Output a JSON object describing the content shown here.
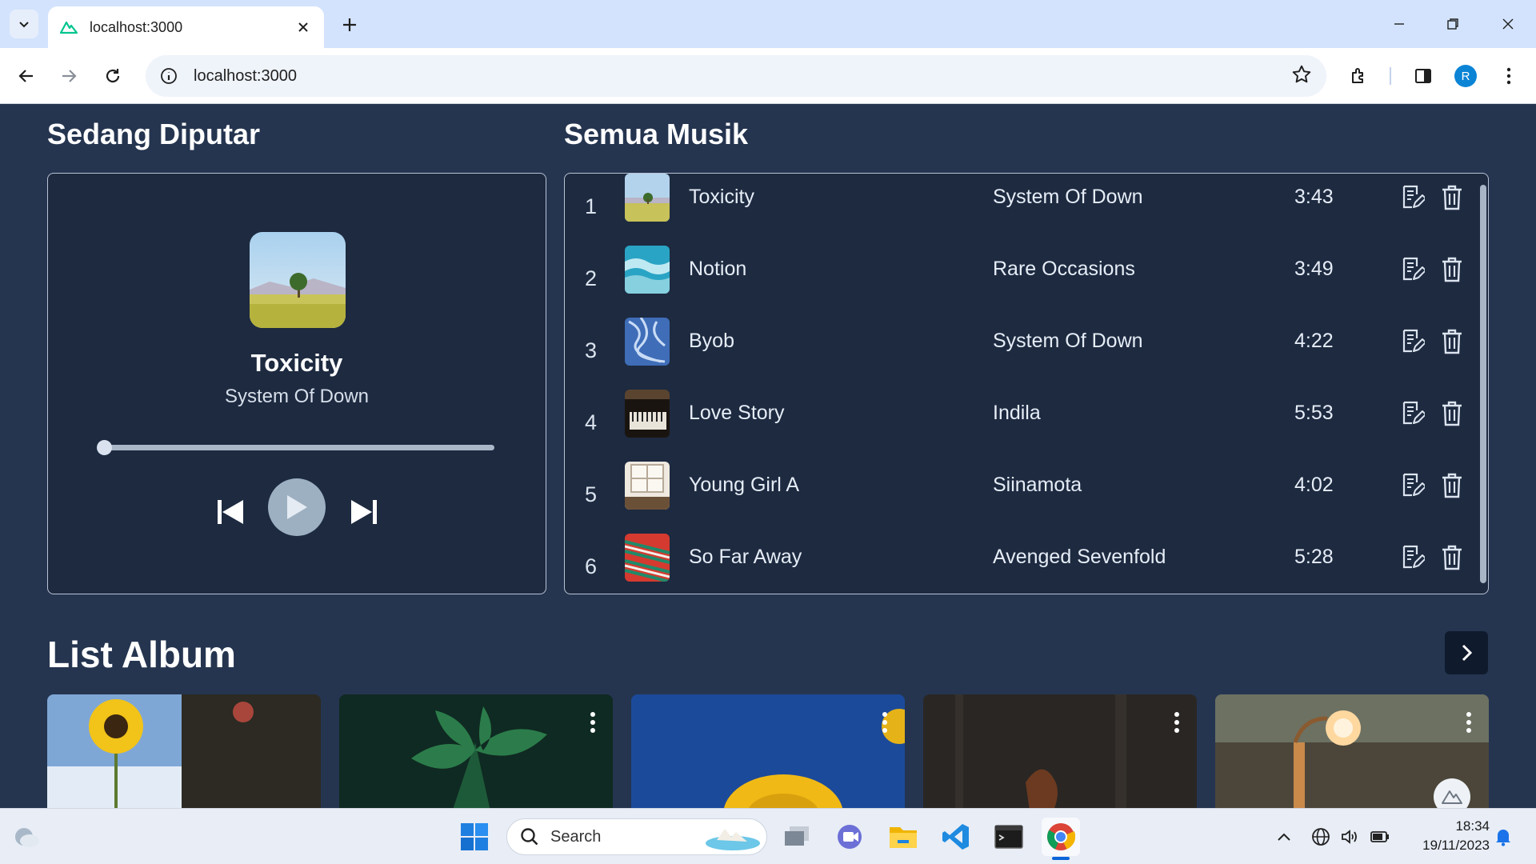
{
  "browser": {
    "tab_title": "localhost:3000",
    "url": "localhost:3000",
    "profile_initial": "R"
  },
  "now_playing": {
    "heading": "Sedang Diputar",
    "title": "Toxicity",
    "artist": "System Of Down",
    "progress": 0.0
  },
  "library": {
    "heading": "Semua Musik",
    "tracks": [
      {
        "no": "1",
        "title": "Toxicity",
        "artist": "System Of Down",
        "duration": "3:43"
      },
      {
        "no": "2",
        "title": "Notion",
        "artist": "Rare Occasions",
        "duration": "3:49"
      },
      {
        "no": "3",
        "title": "Byob",
        "artist": "System Of Down",
        "duration": "4:22"
      },
      {
        "no": "4",
        "title": "Love Story",
        "artist": "Indila",
        "duration": "5:53"
      },
      {
        "no": "5",
        "title": "Young Girl A",
        "artist": "Siinamota",
        "duration": "4:02"
      },
      {
        "no": "6",
        "title": "So Far Away",
        "artist": "Avenged Sevenfold",
        "duration": "5:28"
      }
    ]
  },
  "albums": {
    "heading": "List Album"
  },
  "taskbar": {
    "search_label": "Search",
    "time": "18:34",
    "date": "19/11/2023"
  },
  "colors": {
    "page_bg": "#253550",
    "card_bg": "#1d2a40",
    "accent_avatar": "#0b84d6"
  }
}
